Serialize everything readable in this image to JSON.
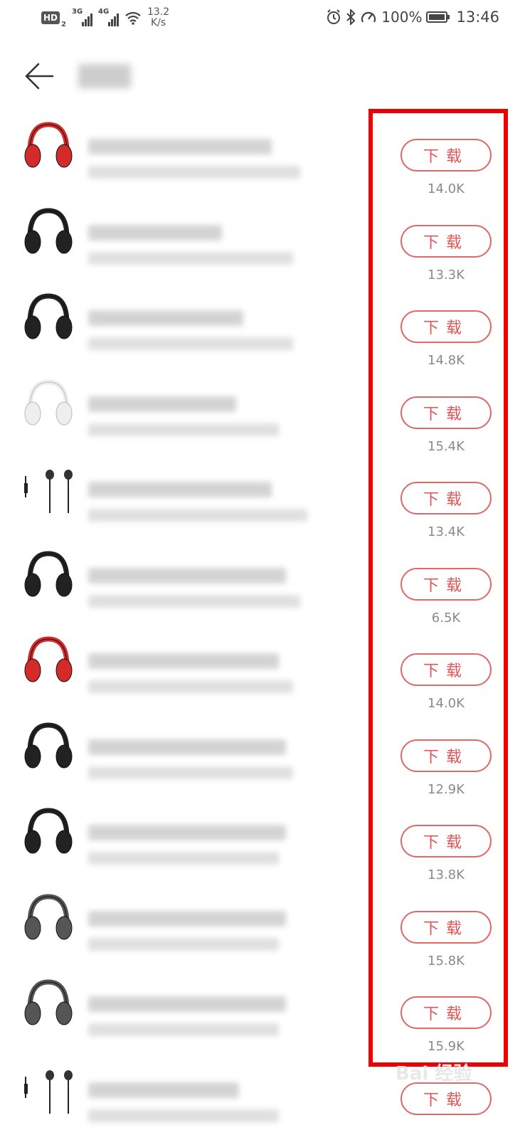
{
  "status_bar": {
    "hd_label": "HD",
    "hd_sub": "2",
    "network1": "3G",
    "network2": "4G",
    "speed_value": "13.2",
    "speed_unit": "K/s",
    "battery": "100%",
    "battery_level": 1.0,
    "time": "13:46"
  },
  "colors": {
    "accent": "#e05555",
    "highlight_border": "#ee0000"
  },
  "items": [
    {
      "icon": "headphone-red-icon",
      "button_label": "下载",
      "size": "14.0K"
    },
    {
      "icon": "headphone-black-icon",
      "button_label": "下载",
      "size": "13.3K"
    },
    {
      "icon": "headphone-dj-icon",
      "button_label": "下载",
      "size": "14.8K"
    },
    {
      "icon": "headphone-white-icon",
      "button_label": "下载",
      "size": "15.4K"
    },
    {
      "icon": "earbuds-icon",
      "button_label": "下载",
      "size": "13.4K"
    },
    {
      "icon": "headphone-black-icon",
      "button_label": "下载",
      "size": "6.5K"
    },
    {
      "icon": "headphone-red-icon",
      "button_label": "下载",
      "size": "14.0K"
    },
    {
      "icon": "headphone-black-icon",
      "button_label": "下载",
      "size": "12.9K"
    },
    {
      "icon": "headphone-black-icon",
      "button_label": "下载",
      "size": "13.8K"
    },
    {
      "icon": "headphone-grey-icon",
      "button_label": "下载",
      "size": "15.8K"
    },
    {
      "icon": "headphone-grey-icon",
      "button_label": "下载",
      "size": "15.9K"
    },
    {
      "icon": "earbuds-grey-icon",
      "button_label": "下载",
      "size": ""
    }
  ]
}
